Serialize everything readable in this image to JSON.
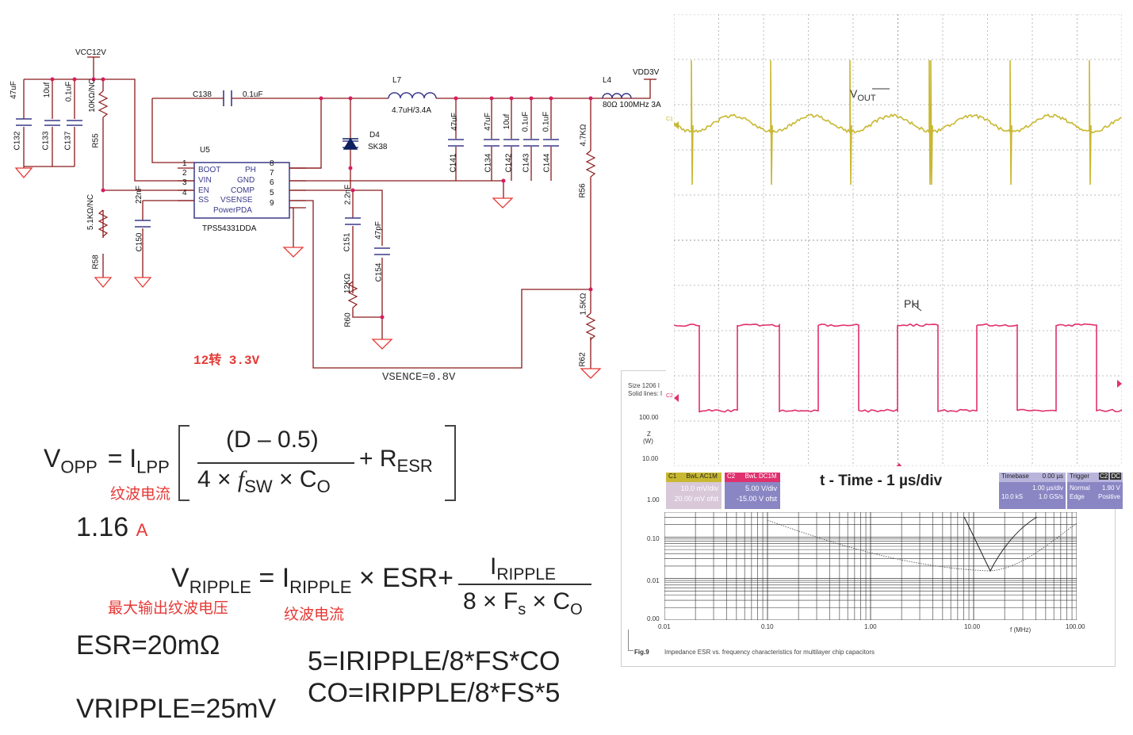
{
  "schematic": {
    "supply_in": "VCC12V",
    "supply_out": "VDD3V",
    "ic_ref": "U5",
    "ic_part": "TPS54331DDA",
    "ic_pins_left": [
      {
        "num": "1",
        "name": "BOOT"
      },
      {
        "num": "2",
        "name": "VIN"
      },
      {
        "num": "3",
        "name": "EN"
      },
      {
        "num": "4",
        "name": "SS"
      }
    ],
    "ic_pins_right": [
      {
        "num": "8",
        "name": "PH"
      },
      {
        "num": "7",
        "name": "GND"
      },
      {
        "num": "6",
        "name": "COMP"
      },
      {
        "num": "5",
        "name": "VSENSE"
      },
      {
        "num": "9",
        "name": "PowerPDA"
      }
    ],
    "components": {
      "c132": {
        "ref": "C132",
        "value": "47uF"
      },
      "c133": {
        "ref": "C133",
        "value": "10uf"
      },
      "c137": {
        "ref": "C137",
        "value": "0.1uF"
      },
      "r55": {
        "ref": "R55",
        "value": "10KΩ/NC"
      },
      "r58": {
        "ref": "R58",
        "value": "5.1KΩ/NC"
      },
      "c150": {
        "ref": "C150",
        "value": "22nF"
      },
      "c138": {
        "ref": "C138",
        "value": "0.1uF"
      },
      "l7": {
        "ref": "L7",
        "value": "4.7uH/3.4A"
      },
      "d4": {
        "ref": "D4",
        "value": "SK38"
      },
      "c151": {
        "ref": "C151",
        "value": "2.2nF"
      },
      "c154": {
        "ref": "C154",
        "value": "47pF"
      },
      "r60": {
        "ref": "R60",
        "value": "12KΩ"
      },
      "c141": {
        "ref": "C141",
        "value": "47uF"
      },
      "c134": {
        "ref": "C134",
        "value": "47uF"
      },
      "c142": {
        "ref": "C142",
        "value": "10uf"
      },
      "c143": {
        "ref": "C143",
        "value": "0.1uF"
      },
      "c144": {
        "ref": "C144",
        "value": "0.1uF"
      },
      "l4": {
        "ref": "L4",
        "value": "80Ω 100MHz 3A"
      },
      "r56": {
        "ref": "R56",
        "value": "4.7KΩ"
      },
      "r62": {
        "ref": "R62",
        "value": "1.5KΩ"
      }
    },
    "title_note": "12转 3.3V",
    "vsence_note": "VSENCE=0.8V"
  },
  "formulas": {
    "f1_lhs": "V",
    "f1_lhs_sub": "OPP",
    "f1_i": "I",
    "f1_i_sub": "LPP",
    "f1_num": "(D – 0.5)",
    "f1_den_a": "4 ×",
    "f1_den_f": "f",
    "f1_den_fsub": "SW",
    "f1_den_b": "× C",
    "f1_den_bsub": "O",
    "f1_plus": "+ R",
    "f1_plus_sub": "ESR",
    "f1_note": "纹波电流",
    "result_value": "1.16",
    "result_unit": "A",
    "f2_lhs": "V",
    "f2_lhs_sub": "RIPPLE",
    "f2_i": "= I",
    "f2_i_sub": "RIPPLE",
    "f2_mid": "× ESR+",
    "f2_num": "I",
    "f2_num_sub": "RIPPLE",
    "f2_den_a": "8 × F",
    "f2_den_asub": "s",
    "f2_den_b": "× C",
    "f2_den_bsub": "O",
    "f2_note_left": "最大输出纹波电压",
    "f2_note_right": "纹波电流",
    "esr": "ESR=20mΩ",
    "vripple": "VRIPPLE=25mV",
    "eq1": "5=IRIPPLE/8*FS*CO",
    "eq2": "CO=IRIPPLE/8*FS*5"
  },
  "scope": {
    "ch1_label": "V",
    "ch1_sub": "OUT",
    "ch2_label": "PH",
    "ch1_marker": "C1",
    "ch2_marker": "C2",
    "time_label": "t - Time - 1 µs/div",
    "ch1_color": "#c8b832",
    "ch2_color": "#e0306e",
    "ch1_badge": {
      "name": "C1",
      "mode": "BwL AC1M",
      "line1": "10.0 mV/div",
      "line2": "20.00 mV ofst"
    },
    "ch2_badge": {
      "name": "C2",
      "mode": "BwL DC1M",
      "line1": "5.00 V/div",
      "line2": "-15.00 V ofst"
    },
    "timebase": {
      "title": "Timebase",
      "offset": "0.00 µs",
      "line1": "1.00 µs/div",
      "line2a": "10.0 kS",
      "line2b": "1.0 GS/s"
    },
    "trigger": {
      "title": "Trigger",
      "ch": "C2",
      "cpl": "DC",
      "line1a": "Normal",
      "line1b": "1.90 V",
      "line2a": "Edge",
      "line2b": "Positive"
    }
  },
  "impedance_chart": {
    "header1": "Size 1206 I",
    "header2": "Solid lines: I",
    "ylabel_top": "Z",
    "ylabel_bottom": "(W)",
    "fig_label": "Fig.9",
    "caption": "Impedance ESR vs. frequency characteristics for multilayer chip capacitors",
    "xlabel": "f (MHz)",
    "y_ticks": [
      "100.00",
      "10.00",
      "1.00",
      "0.10",
      "0.01",
      "0.00"
    ],
    "x_ticks": [
      "0.01",
      "0.10",
      "1.00",
      "10.00",
      "100.00"
    ]
  }
}
